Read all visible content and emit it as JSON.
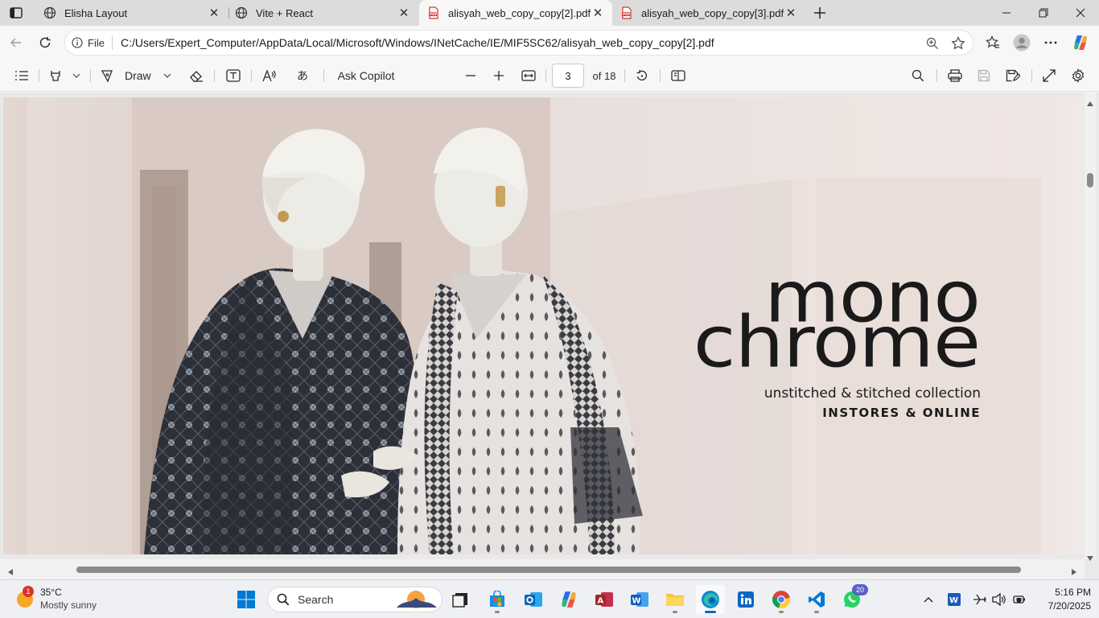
{
  "browser": {
    "tabs": [
      {
        "label": "Elisha Layout",
        "icon": "globe-icon",
        "active": false
      },
      {
        "label": "Vite + React",
        "icon": "globe-icon",
        "active": false
      },
      {
        "label": "alisyah_web_copy_copy[2].pdf",
        "icon": "pdf-icon",
        "active": true
      },
      {
        "label": "alisyah_web_copy_copy[3].pdf",
        "icon": "pdf-icon",
        "active": false
      }
    ],
    "address": {
      "scheme_label": "File",
      "url": "C:/Users/Expert_Computer/AppData/Local/Microsoft/Windows/INetCache/IE/MIF5SC62/alisyah_web_copy_copy[2].pdf"
    }
  },
  "pdf_toolbar": {
    "draw_label": "Draw",
    "ask_copilot_label": "Ask Copilot",
    "page_number": "3",
    "page_total": "of 18"
  },
  "document": {
    "headline_line1": "mono",
    "headline_line2": "chrome",
    "subtitle": "unstitched & stitched collection",
    "tagline": "INSTORES & ONLINE"
  },
  "taskbar": {
    "weather": {
      "temp": "35°C",
      "condition": "Mostly sunny",
      "badge": "1"
    },
    "search_placeholder": "Search",
    "whatsapp_badge": "20",
    "clock": {
      "time": "5:16 PM",
      "date": "7/20/2025"
    }
  },
  "colors": {
    "accent": "#0067c0",
    "edge_blue": "#0078d4",
    "pdf_red": "#d9342b"
  }
}
